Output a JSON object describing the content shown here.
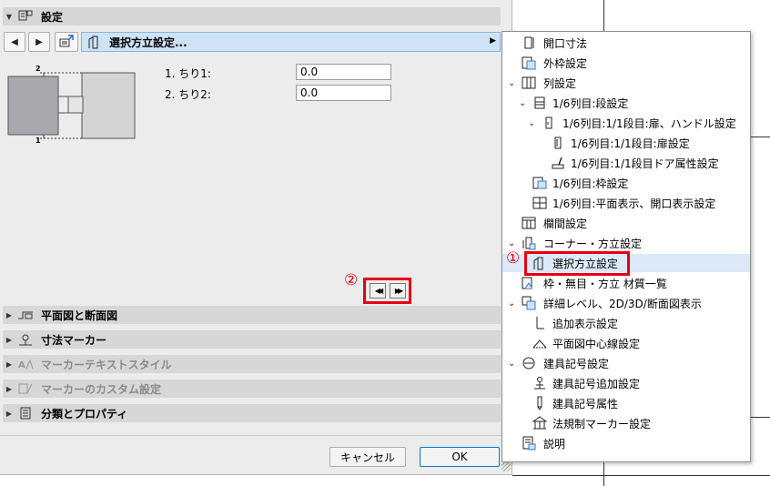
{
  "dialog": {
    "section_title": "設定",
    "selector_label": "選択方立設定...",
    "field1_label": "1. ちり1:",
    "field1_value": "0.0",
    "field2_label": "2. ちり2:",
    "field2_value": "0.0",
    "diagram_label_top": "2",
    "diagram_label_bottom": "1",
    "panels": [
      {
        "label": "平面図と断面図",
        "enabled": true
      },
      {
        "label": "寸法マーカー",
        "enabled": true
      },
      {
        "label": "マーカーテキストスタイル",
        "enabled": false
      },
      {
        "label": "マーカーのカスタム設定",
        "enabled": false
      },
      {
        "label": "分類とプロパティ",
        "enabled": true
      }
    ],
    "cancel_label": "キャンセル",
    "ok_label": "OK"
  },
  "annotations": {
    "marker1": "①",
    "marker2": "②"
  },
  "menu": {
    "items": [
      {
        "label": "開口寸法",
        "icon": "opening-dimension-icon"
      },
      {
        "label": "外枠設定",
        "icon": "outer-frame-icon"
      },
      {
        "label": "列設定",
        "icon": "column-icon"
      },
      {
        "label": "1/6列目:段設定",
        "icon": "row-icon"
      },
      {
        "label": "1/6列目:1/1段目:扉、ハンドル設定",
        "icon": "door-handle-icon"
      },
      {
        "label": "1/6列目:1/1段目:扉設定",
        "icon": "door-icon"
      },
      {
        "label": "1/6列目:1/1段目ドア属性設定",
        "icon": "paint-brush-icon"
      },
      {
        "label": "1/6列目:枠設定",
        "icon": "frame-icon"
      },
      {
        "label": "1/6列目:平面表示、開口表示設定",
        "icon": "plan-grid-icon"
      },
      {
        "label": "欄間設定",
        "icon": "transom-icon"
      },
      {
        "label": "コーナー・方立設定",
        "icon": "corner-mullion-icon"
      },
      {
        "label": "選択方立設定",
        "icon": "mullion-icon"
      },
      {
        "label": "枠・無目・方立 材質一覧",
        "icon": "materials-icon"
      },
      {
        "label": "詳細レベル、2D/3D/断面図表示",
        "icon": "detail-level-icon"
      },
      {
        "label": "追加表示設定",
        "icon": "additional-display-icon"
      },
      {
        "label": "平面図中心線設定",
        "icon": "centerline-icon"
      },
      {
        "label": "建具記号設定",
        "icon": "minus-circle-icon"
      },
      {
        "label": "建具記号追加設定",
        "icon": "marker-add-icon"
      },
      {
        "label": "建具記号属性",
        "icon": "pen-icon"
      },
      {
        "label": "法規制マーカー設定",
        "icon": "building-icon"
      },
      {
        "label": "説明",
        "icon": "document-icon"
      }
    ]
  },
  "colors": {
    "highlight": "#dbe9f9",
    "dropdown": "#cfe3f7",
    "annotation_red": "#e60012",
    "panel_header": "#d7d7d7"
  }
}
